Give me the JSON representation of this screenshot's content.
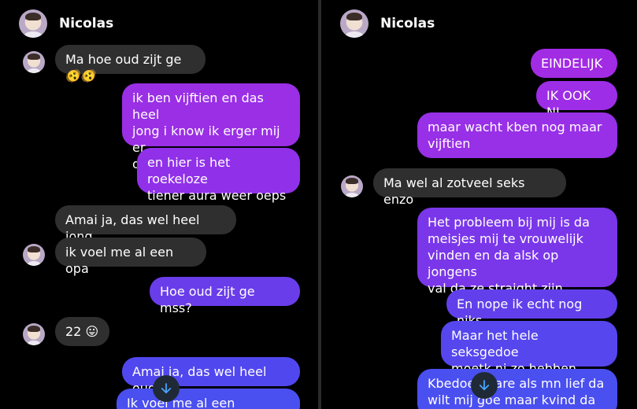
{
  "left": {
    "contact_name": "Nicolas",
    "messages": [
      {
        "dir": "in",
        "text": "Ma hoe oud zijt ge 🫨🫨"
      },
      {
        "dir": "out",
        "text": "ik ben vijftien en das heel\njong i know ik erger mij er\nook aan"
      },
      {
        "dir": "out",
        "text": "en hier is het roekeloze\ntiener aura weer oeps"
      },
      {
        "dir": "in",
        "text": "Amai ja, das wel heel jong"
      },
      {
        "dir": "in",
        "text": "ik voel me al een opa"
      },
      {
        "dir": "out",
        "text": "Hoe oud zijt ge mss?"
      },
      {
        "dir": "in",
        "text": "22 😛"
      },
      {
        "dir": "out",
        "text": "Amai ja, das wel heel oud"
      },
      {
        "dir": "out",
        "text": "Ik voel me al een kleinkind"
      }
    ]
  },
  "right": {
    "contact_name": "Nicolas",
    "messages": [
      {
        "dir": "out",
        "text": "EINDELIJK"
      },
      {
        "dir": "out",
        "text": "IK OOK NI"
      },
      {
        "dir": "out",
        "text": "maar wacht kben nog maar\nvijftien"
      },
      {
        "dir": "in",
        "text": "Ma wel al zotveel seks enzo"
      },
      {
        "dir": "out",
        "text": "Het probleem bij mij is da\nmeisjes mij te vrouwelijk\nvinden en da alsk op jongens\nval da ze straight zijn"
      },
      {
        "dir": "out",
        "text": "En nope ik echt nog niks"
      },
      {
        "dir": "out",
        "text": "Maar het hele seksgedoe\nmoetk ni zo hebben"
      },
      {
        "dir": "out",
        "text": "Kbedoel mare als mn lief da\nwilt mij goe maar kvind da"
      }
    ]
  },
  "icons": {
    "scroll_down": "arrow-down-icon"
  },
  "colors": {
    "background": "#000000",
    "incoming_bubble": "#2f2f2f",
    "outgoing_purple": "#9b2ee6",
    "outgoing_blue": "#4a4ff0",
    "fab": "#1f2a36",
    "fab_arrow": "#4aa3ff"
  }
}
